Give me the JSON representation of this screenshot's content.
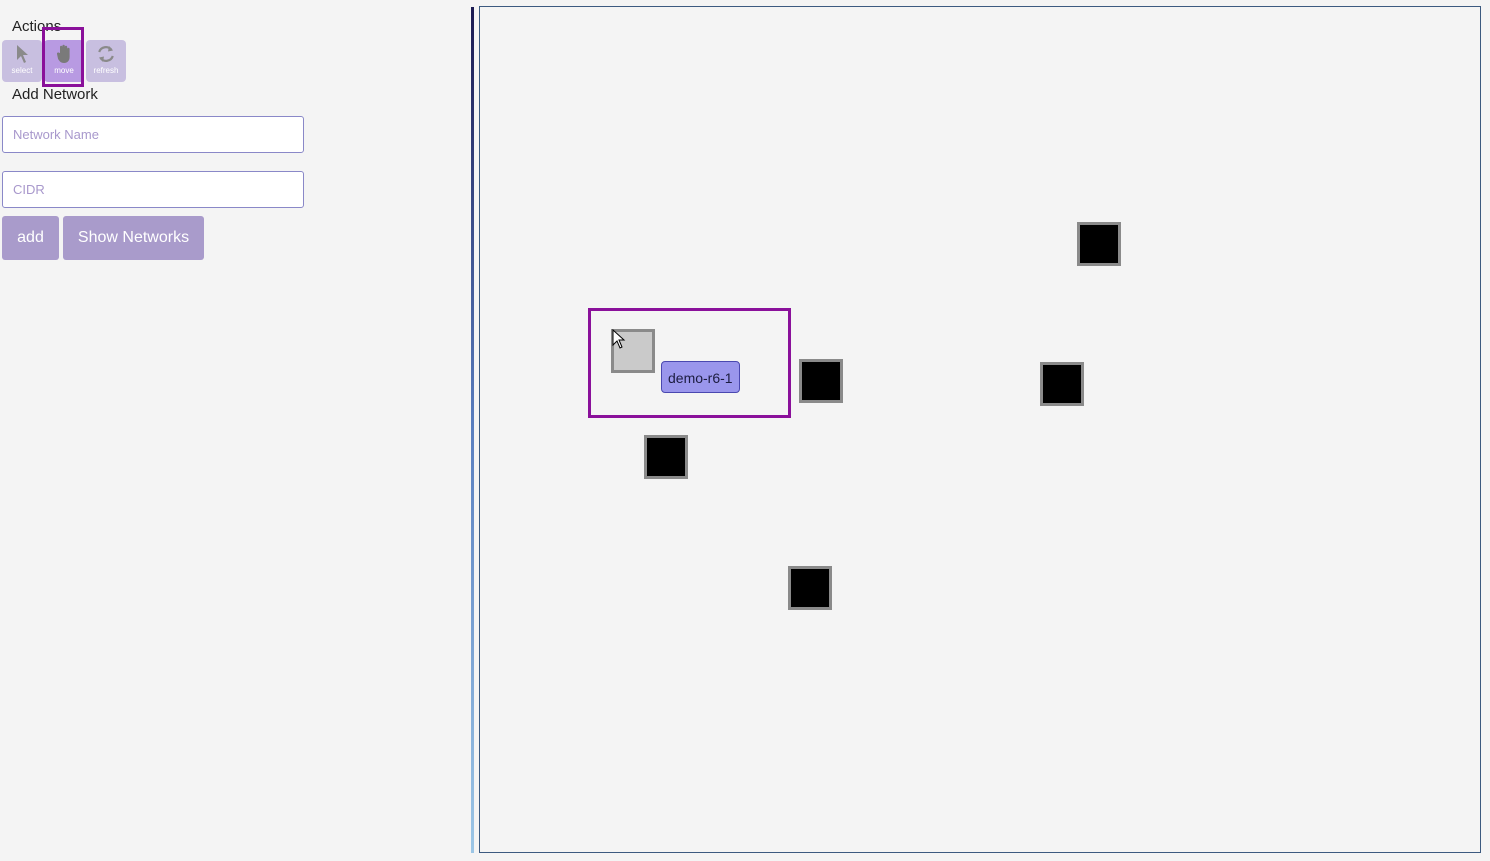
{
  "sidebar": {
    "actions_title": "Actions",
    "tools": [
      {
        "label": "select",
        "icon": "pointer-icon"
      },
      {
        "label": "move",
        "icon": "hand-icon",
        "active": true
      },
      {
        "label": "refresh",
        "icon": "refresh-icon"
      }
    ],
    "add_network_title": "Add Network",
    "network_name_placeholder": "Network Name",
    "cidr_placeholder": "CIDR",
    "add_label": "add",
    "show_networks_label": "Show Networks"
  },
  "canvas": {
    "selected_node_label": "demo-r6-1"
  },
  "colors": {
    "accent": "#8a109a",
    "button": "#a99bcb",
    "label_bg": "#9a96ec"
  }
}
